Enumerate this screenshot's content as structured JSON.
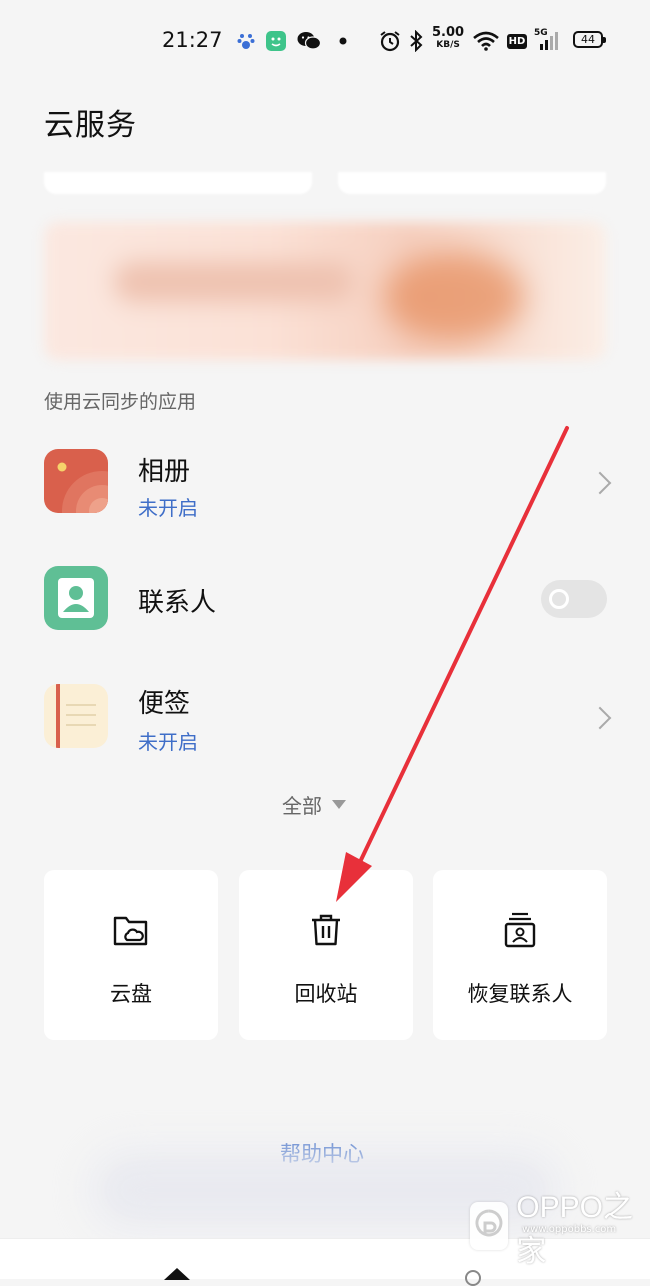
{
  "status_bar": {
    "time": "21:27",
    "net_speed_value": "5.00",
    "net_speed_unit": "KB/S",
    "hd_badge": "HD",
    "signal_label": "5G",
    "battery_level": "44",
    "icons": [
      "baidu-icon",
      "app-badge-icon",
      "wechat-icon",
      "dot-icon",
      "alarm-icon",
      "bluetooth-icon",
      "wifi-icon",
      "signal-icon",
      "battery-icon"
    ]
  },
  "header": {
    "title": "云服务"
  },
  "sync_section": {
    "label": "使用云同步的应用",
    "apps": [
      {
        "name": "相册",
        "status": "未开启",
        "icon": "photos-icon",
        "control": "chevron"
      },
      {
        "name": "联系人",
        "icon": "contacts-icon",
        "control": "toggle",
        "toggle_on": false
      },
      {
        "name": "便签",
        "status": "未开启",
        "icon": "notes-icon",
        "control": "chevron"
      }
    ],
    "expand_label": "全部"
  },
  "tiles": [
    {
      "label": "云盘",
      "icon": "cloud-folder-icon"
    },
    {
      "label": "回收站",
      "icon": "trash-icon"
    },
    {
      "label": "恢复联系人",
      "icon": "restore-contacts-icon"
    }
  ],
  "help_link": "帮助中心",
  "watermark": {
    "brand": "OPPO之家",
    "url": "www.oppobbs.com"
  },
  "colors": {
    "background": "#f5f5f5",
    "link_blue": "#3f6ec8",
    "photos_icon": "#d9604c",
    "contacts_icon": "#5fbf95",
    "notes_icon": "#fbefd6",
    "annotation_arrow": "#e8303a"
  }
}
